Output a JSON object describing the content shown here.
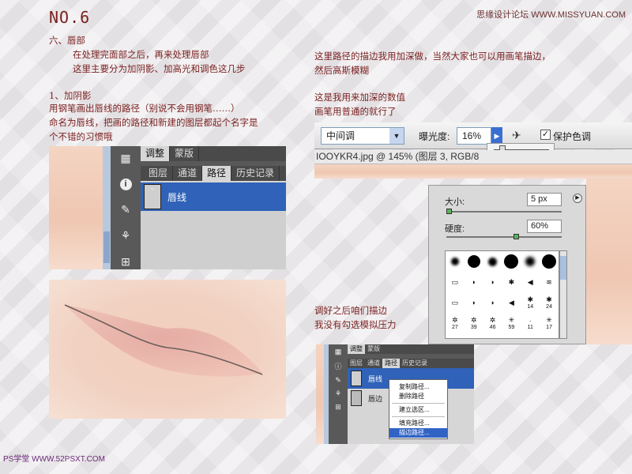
{
  "header": {
    "title": "NO.6",
    "site": "思缘设计论坛 WWW.MISSYUAN.COM"
  },
  "left_text": {
    "section": "六、唇部",
    "intro1": "在处理完面部之后，再来处理唇部",
    "intro2": "这里主要分为加阴影、加高光和调色这几步",
    "step": "1、加阴影",
    "p1": "用钢笔画出唇线的路径（别说不会用钢笔……）",
    "p2": "命名为唇线，把画的路径和新建的图层都起个名字是",
    "p3": "个不错的习惯哦"
  },
  "right_text": {
    "r1": "这里路径的描边我用加深做，当然大家也可以用画笔描边，",
    "r2": "然后高斯模糊",
    "r3": "这是我用来加深的数值",
    "r4": "画笔用普通的就行了",
    "r5": "调好之后咱们描边",
    "r6": "我没有勾选模拟压力"
  },
  "paths_panel": {
    "tabs_top": [
      "调整",
      "蒙版"
    ],
    "tabs": [
      "图层",
      "通道",
      "路径",
      "历史记录"
    ],
    "active_tab_index": 2,
    "path_name": "唇线"
  },
  "options_bar": {
    "range_value": "中间调",
    "exposure_label": "曝光度:",
    "exposure_value": "16%",
    "exposure_level": 0.16,
    "protect_label": "保护色调",
    "protect_checked": true
  },
  "doc_title": "IOOYKR4.jpg @ 145% (图层 3, RGB/8",
  "brush_panel": {
    "size_label": "大小:",
    "size_value": "5 px",
    "size_level": 0.02,
    "hardness_label": "硬度:",
    "hardness_value": "60%",
    "hardness_level": 0.6,
    "preset_labels": [
      "14",
      "24",
      "27",
      "39",
      "46",
      "59",
      "11",
      "17"
    ]
  },
  "small_panel": {
    "tabs_top": [
      "调整",
      "蒙版"
    ],
    "tabs": [
      "图层",
      "通道",
      "路径",
      "历史记录"
    ],
    "rows": [
      "唇线",
      "唇边"
    ]
  },
  "context_menu": {
    "items": [
      "复制路径...",
      "删除路径",
      "建立选区...",
      "填充路径...",
      "描边路径..."
    ],
    "highlighted_index": 4
  },
  "footer": {
    "logo": "PS学堂 WWW.52PSXT.COM"
  }
}
